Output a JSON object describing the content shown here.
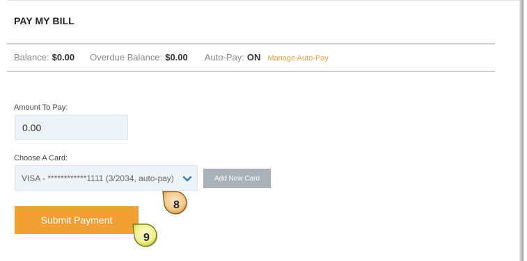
{
  "title": "PAY MY BILL",
  "summary": {
    "balance_label": "Balance:",
    "balance_value": "$0.00",
    "overdue_label": "Overdue Balance:",
    "overdue_value": "$0.00",
    "autopay_label": "Auto-Pay:",
    "autopay_value": "ON",
    "manage_link": "Manage Auto-Pay"
  },
  "amount": {
    "label": "Amount To Pay:",
    "value": "0.00"
  },
  "card": {
    "label": "Choose A Card:",
    "selected": "VISA - ************1111 (3/2034, auto-pay)",
    "add_button": "Add New Card"
  },
  "submit_button": "Submit Payment",
  "callouts": {
    "step8": "8",
    "step9": "9"
  },
  "colors": {
    "accent": "#f2a033",
    "link": "#f0a048",
    "input_bg": "#eef3f8",
    "secondary_button": "#aab1b8",
    "chevron": "#2b7bc0"
  }
}
